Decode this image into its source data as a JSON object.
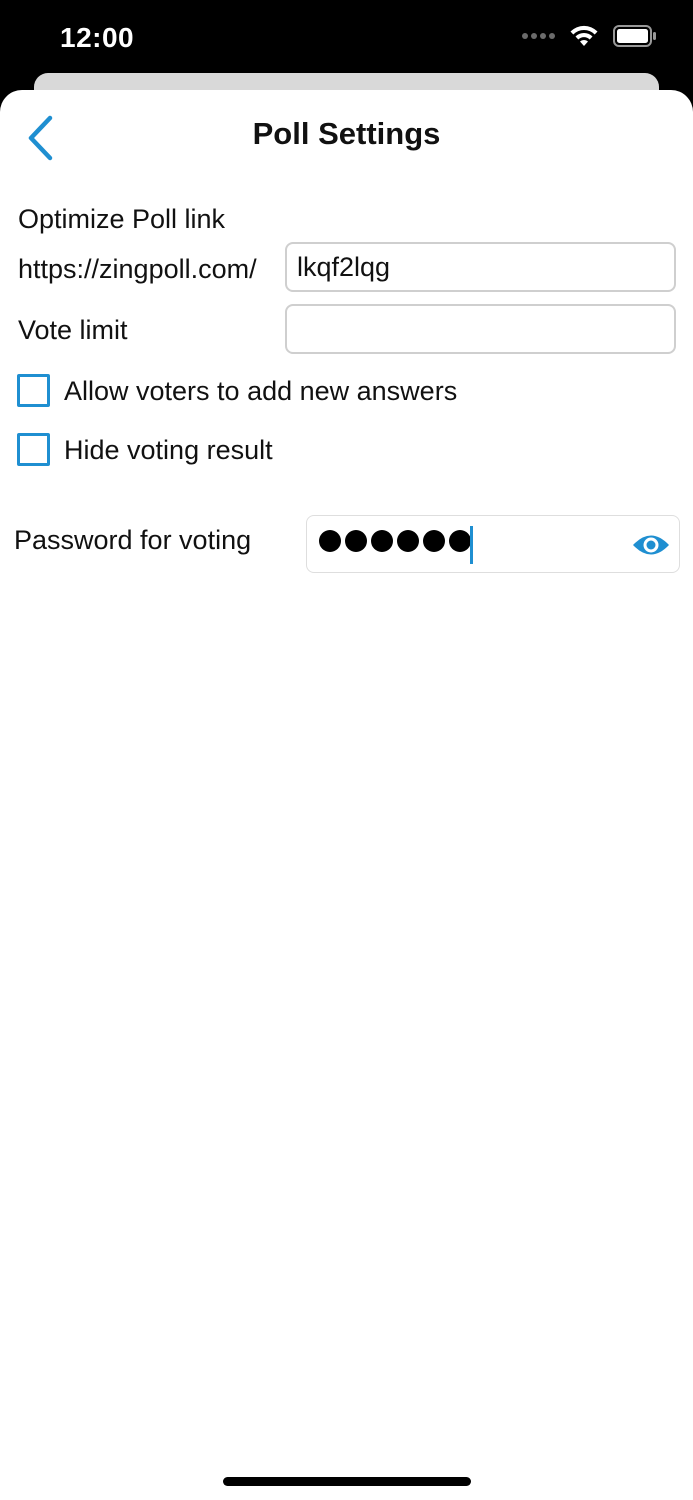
{
  "status_bar": {
    "time": "12:00",
    "icons": [
      "signal-dots-icon",
      "wifi-icon",
      "battery-icon"
    ]
  },
  "nav": {
    "title": "Poll Settings",
    "back_icon": "chevron-left-icon"
  },
  "form": {
    "optimize_label": "Optimize Poll link",
    "link_prefix": "https://zingpoll.com/",
    "link_slug": "lkqf2lqg",
    "vote_limit_label": "Vote limit",
    "vote_limit_value": "",
    "allow_answers_label": "Allow voters to add new answers",
    "allow_answers_checked": false,
    "hide_result_label": "Hide voting result",
    "hide_result_checked": false,
    "password_label": "Password for voting",
    "password_masked_length": 6,
    "password_reveal_icon": "eye-icon"
  },
  "colors": {
    "accent": "#1f8fd1",
    "text": "#111111",
    "field_border": "#cfcfcf"
  }
}
